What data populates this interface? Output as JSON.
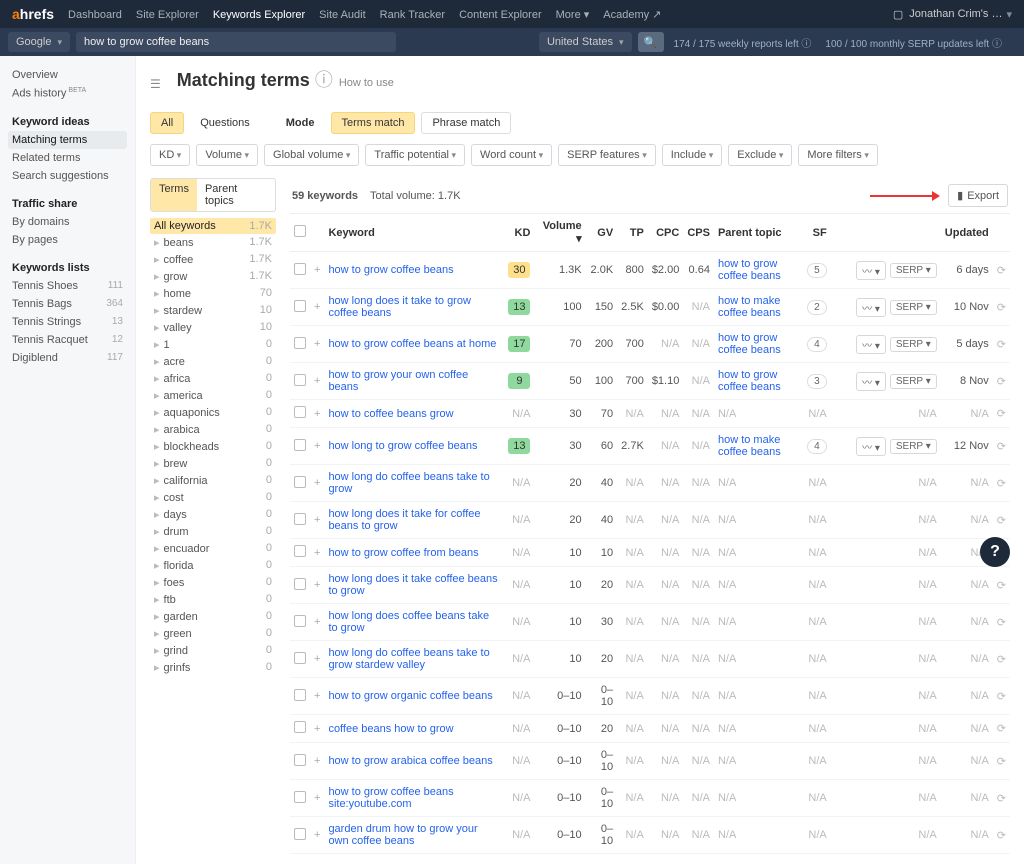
{
  "topnav": {
    "logo_a": "a",
    "logo_hrefs": "hrefs",
    "items": [
      "Dashboard",
      "Site Explorer",
      "Keywords Explorer",
      "Site Audit",
      "Rank Tracker",
      "Content Explorer",
      "More",
      "Academy ↗"
    ],
    "active_index": 2,
    "user": "Jonathan Crim's …"
  },
  "subnav": {
    "engine": "Google",
    "query": "how to grow coffee beans",
    "country": "United States",
    "stats1": "174 / 175 weekly reports left",
    "stats2": "100 / 100 monthly SERP updates left"
  },
  "leftnav": {
    "overview": "Overview",
    "ads_history": "Ads history",
    "keyword_ideas": "Keyword ideas",
    "matching_terms": "Matching terms",
    "related_terms": "Related terms",
    "search_suggestions": "Search suggestions",
    "traffic_share": "Traffic share",
    "by_domains": "By domains",
    "by_pages": "By pages",
    "keywords_lists": "Keywords lists",
    "lists": [
      {
        "name": "Tennis Shoes",
        "count": "111"
      },
      {
        "name": "Tennis Bags",
        "count": "364"
      },
      {
        "name": "Tennis Strings",
        "count": "13"
      },
      {
        "name": "Tennis Racquet",
        "count": "12"
      },
      {
        "name": "Digiblend",
        "count": "117"
      }
    ]
  },
  "page": {
    "title": "Matching terms",
    "howto": "How to use",
    "tabs": {
      "all": "All",
      "questions": "Questions",
      "mode": "Mode",
      "terms_match": "Terms match",
      "phrase_match": "Phrase match"
    },
    "filters": [
      "KD",
      "Volume",
      "Global volume",
      "Traffic potential",
      "Word count",
      "SERP features",
      "Include",
      "Exclude",
      "More filters"
    ]
  },
  "sidepanel": {
    "tab_terms": "Terms",
    "tab_parent": "Parent topics",
    "rows": [
      {
        "name": "All keywords",
        "count": "1.7K",
        "active": true
      },
      {
        "name": "beans",
        "count": "1.7K",
        "indent": true
      },
      {
        "name": "coffee",
        "count": "1.7K",
        "indent": true
      },
      {
        "name": "grow",
        "count": "1.7K",
        "indent": true
      },
      {
        "name": "home",
        "count": "70",
        "indent": true
      },
      {
        "name": "stardew",
        "count": "10",
        "indent": true
      },
      {
        "name": "valley",
        "count": "10",
        "indent": true
      },
      {
        "name": "1",
        "count": "0",
        "indent": true
      },
      {
        "name": "acre",
        "count": "0",
        "indent": true
      },
      {
        "name": "africa",
        "count": "0",
        "indent": true
      },
      {
        "name": "america",
        "count": "0",
        "indent": true
      },
      {
        "name": "aquaponics",
        "count": "0",
        "indent": true
      },
      {
        "name": "arabica",
        "count": "0",
        "indent": true
      },
      {
        "name": "blockheads",
        "count": "0",
        "indent": true
      },
      {
        "name": "brew",
        "count": "0",
        "indent": true
      },
      {
        "name": "california",
        "count": "0",
        "indent": true
      },
      {
        "name": "cost",
        "count": "0",
        "indent": true
      },
      {
        "name": "days",
        "count": "0",
        "indent": true
      },
      {
        "name": "drum",
        "count": "0",
        "indent": true
      },
      {
        "name": "encuador",
        "count": "0",
        "indent": true
      },
      {
        "name": "florida",
        "count": "0",
        "indent": true
      },
      {
        "name": "foes",
        "count": "0",
        "indent": true
      },
      {
        "name": "ftb",
        "count": "0",
        "indent": true
      },
      {
        "name": "garden",
        "count": "0",
        "indent": true
      },
      {
        "name": "green",
        "count": "0",
        "indent": true
      },
      {
        "name": "grind",
        "count": "0",
        "indent": true
      },
      {
        "name": "grinfs",
        "count": "0",
        "indent": true
      }
    ]
  },
  "results": {
    "count_label": "59 keywords",
    "totalvol_label": "Total volume: 1.7K",
    "export": "Export",
    "headers": {
      "keyword": "Keyword",
      "kd": "KD",
      "volume": "Volume",
      "gv": "GV",
      "tp": "TP",
      "cpc": "CPC",
      "cps": "CPS",
      "parent": "Parent topic",
      "sf": "SF",
      "updated": "Updated"
    },
    "serp_btn": "SERP",
    "rows": [
      {
        "kw": "how to grow coffee beans",
        "kd": "30",
        "kdc": "y",
        "vol": "1.3K",
        "gv": "2.0K",
        "tp": "800",
        "cpc": "$2.00",
        "cps": "0.64",
        "pt": "how to grow coffee beans",
        "sf": "5",
        "chart": true,
        "upd": "6 days"
      },
      {
        "kw": "how long does it take to grow coffee beans",
        "kd": "13",
        "kdc": "g",
        "vol": "100",
        "gv": "150",
        "tp": "2.5K",
        "cpc": "$0.00",
        "cps": "N/A",
        "pt": "how to make coffee beans",
        "sf": "2",
        "chart": true,
        "upd": "10 Nov"
      },
      {
        "kw": "how to grow coffee beans at home",
        "kd": "17",
        "kdc": "g",
        "vol": "70",
        "gv": "200",
        "tp": "700",
        "cpc": "N/A",
        "cps": "N/A",
        "pt": "how to grow coffee beans",
        "sf": "4",
        "chart": true,
        "upd": "5 days"
      },
      {
        "kw": "how to grow your own coffee beans",
        "kd": "9",
        "kdc": "g",
        "vol": "50",
        "gv": "100",
        "tp": "700",
        "cpc": "$1.10",
        "cps": "N/A",
        "pt": "how to grow coffee beans",
        "sf": "3",
        "chart": true,
        "upd": "8 Nov"
      },
      {
        "kw": "how to coffee beans grow",
        "kd": "N/A",
        "vol": "30",
        "gv": "70",
        "tp": "N/A",
        "cpc": "N/A",
        "cps": "N/A",
        "pt": "N/A",
        "upd": "N/A"
      },
      {
        "kw": "how long to grow coffee beans",
        "kd": "13",
        "kdc": "g",
        "vol": "30",
        "gv": "60",
        "tp": "2.7K",
        "cpc": "N/A",
        "cps": "N/A",
        "pt": "how to make coffee beans",
        "sf": "4",
        "chart": true,
        "upd": "12 Nov"
      },
      {
        "kw": "how long do coffee beans take to grow",
        "kd": "N/A",
        "vol": "20",
        "gv": "40",
        "tp": "N/A",
        "cpc": "N/A",
        "cps": "N/A",
        "pt": "N/A",
        "upd": "N/A"
      },
      {
        "kw": "how long does it take for coffee beans to grow",
        "kd": "N/A",
        "vol": "20",
        "gv": "40",
        "tp": "N/A",
        "cpc": "N/A",
        "cps": "N/A",
        "pt": "N/A",
        "upd": "N/A"
      },
      {
        "kw": "how to grow coffee from beans",
        "kd": "N/A",
        "vol": "10",
        "gv": "10",
        "tp": "N/A",
        "cpc": "N/A",
        "cps": "N/A",
        "pt": "N/A",
        "upd": "N/A"
      },
      {
        "kw": "how long does it take coffee beans to grow",
        "kd": "N/A",
        "vol": "10",
        "gv": "20",
        "tp": "N/A",
        "cpc": "N/A",
        "cps": "N/A",
        "pt": "N/A",
        "upd": "N/A"
      },
      {
        "kw": "how long does coffee beans take to grow",
        "kd": "N/A",
        "vol": "10",
        "gv": "30",
        "tp": "N/A",
        "cpc": "N/A",
        "cps": "N/A",
        "pt": "N/A",
        "upd": "N/A"
      },
      {
        "kw": "how long do coffee beans take to grow stardew valley",
        "kd": "N/A",
        "vol": "10",
        "gv": "20",
        "tp": "N/A",
        "cpc": "N/A",
        "cps": "N/A",
        "pt": "N/A",
        "upd": "N/A"
      },
      {
        "kw": "how to grow organic coffee beans",
        "kd": "N/A",
        "vol": "0–10",
        "gv": "0–10",
        "tp": "N/A",
        "cpc": "N/A",
        "cps": "N/A",
        "pt": "N/A",
        "upd": "N/A"
      },
      {
        "kw": "coffee beans how to grow",
        "kd": "N/A",
        "vol": "0–10",
        "gv": "20",
        "tp": "N/A",
        "cpc": "N/A",
        "cps": "N/A",
        "pt": "N/A",
        "upd": "N/A"
      },
      {
        "kw": "how to grow arabica coffee beans",
        "kd": "N/A",
        "vol": "0–10",
        "gv": "0–10",
        "tp": "N/A",
        "cpc": "N/A",
        "cps": "N/A",
        "pt": "N/A",
        "upd": "N/A"
      },
      {
        "kw": "how to grow coffee beans site:youtube.com",
        "kd": "N/A",
        "vol": "0–10",
        "gv": "0–10",
        "tp": "N/A",
        "cpc": "N/A",
        "cps": "N/A",
        "pt": "N/A",
        "upd": "N/A"
      },
      {
        "kw": "garden drum how to grow your own coffee beans",
        "kd": "N/A",
        "vol": "0–10",
        "gv": "0–10",
        "tp": "N/A",
        "cpc": "N/A",
        "cps": "N/A",
        "pt": "N/A",
        "upd": "N/A"
      }
    ]
  }
}
